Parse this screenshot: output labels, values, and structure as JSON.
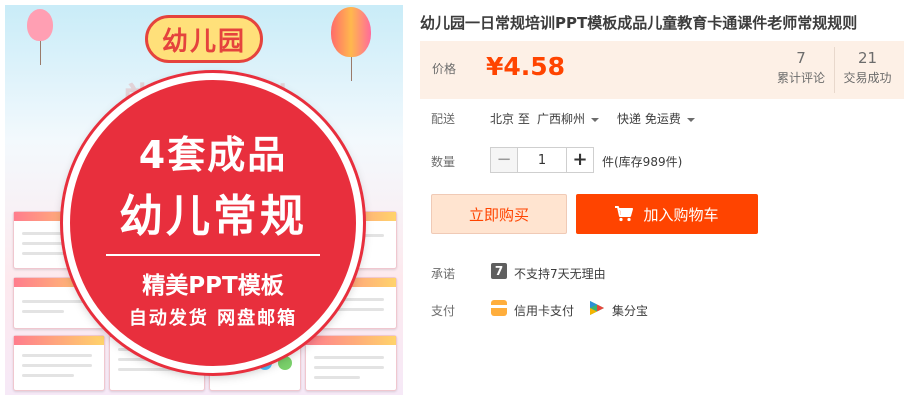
{
  "product_image": {
    "logo_text": "幼儿园",
    "background_title": "常规培训",
    "badge": {
      "line1": "4套成品",
      "line2": "幼儿常规",
      "line3": "精美PPT模板",
      "line4": "自动发货 网盘邮箱"
    }
  },
  "product": {
    "title": "幼儿园一日常规培训PPT模板成品儿童教育卡通课件老师常规规则"
  },
  "price": {
    "label": "价格",
    "value": "¥4.58",
    "stats": [
      {
        "number": "7",
        "label": "累计评论"
      },
      {
        "number": "21",
        "label": "交易成功"
      }
    ]
  },
  "delivery": {
    "label": "配送",
    "origin": "北京 至",
    "destination": "广西柳州",
    "shipping": "快递 免运费"
  },
  "quantity": {
    "label": "数量",
    "minus": "−",
    "value": "1",
    "plus": "+",
    "stock_text": "件(库存989件)"
  },
  "buttons": {
    "buy_now": "立即购买",
    "add_to_cart": "加入购物车"
  },
  "promise": {
    "label": "承诺",
    "icon_glyph": "7",
    "text": "不支持7天无理由"
  },
  "payment": {
    "label": "支付",
    "methods": [
      {
        "icon": "credit-card-icon",
        "label": "信用卡支付"
      },
      {
        "icon": "jifenbao-icon",
        "label": "集分宝"
      }
    ]
  },
  "colors": {
    "accent": "#ff4400",
    "price_bg": "#fdf0e6",
    "buy_bg": "#ffe4d0",
    "badge_red": "#e82f3d"
  }
}
